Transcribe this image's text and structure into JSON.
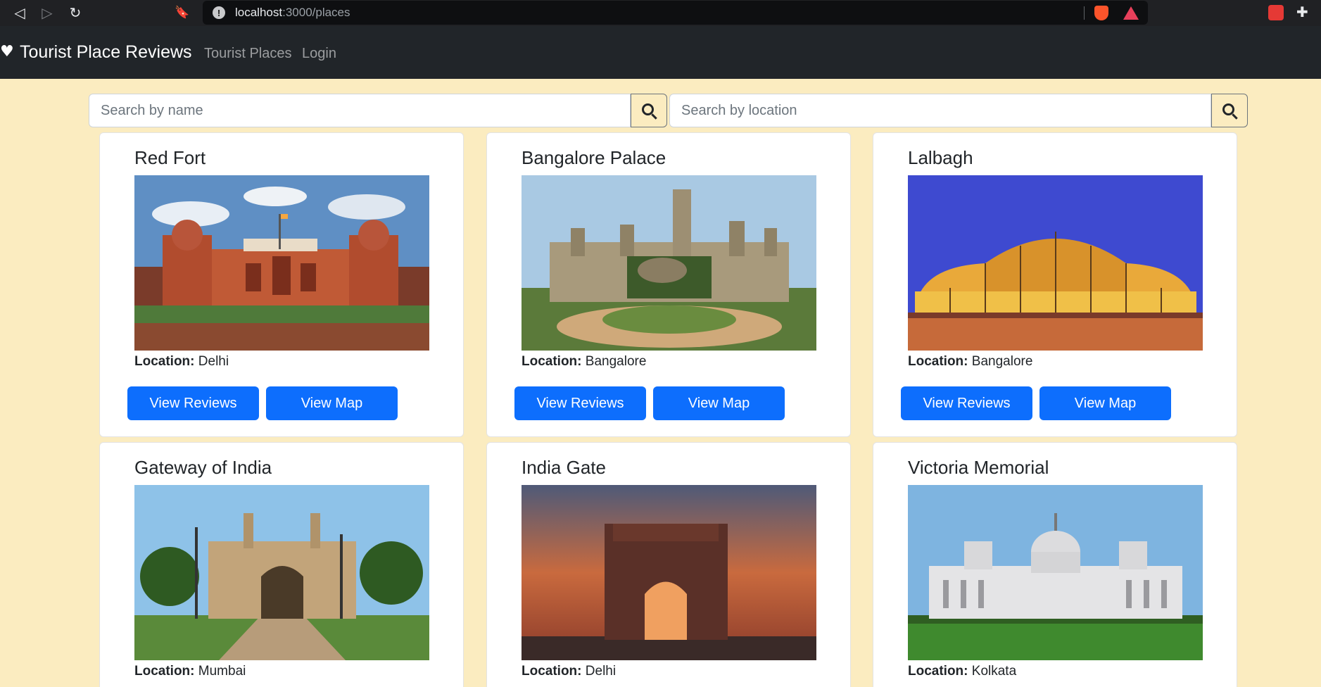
{
  "browser": {
    "url_host": "localhost",
    "url_rest": ":3000/places"
  },
  "navbar": {
    "brand": "Tourist Place Reviews",
    "links": [
      "Tourist Places",
      "Login"
    ]
  },
  "search": {
    "name_placeholder": "Search by name",
    "location_placeholder": "Search by location"
  },
  "location_label": "Location:",
  "buttons": {
    "reviews": "View Reviews",
    "map": "View Map"
  },
  "places": [
    {
      "name": "Red Fort",
      "location": "Delhi"
    },
    {
      "name": "Bangalore Palace",
      "location": "Bangalore"
    },
    {
      "name": "Lalbagh",
      "location": "Bangalore"
    },
    {
      "name": "Gateway of India",
      "location": "Mumbai"
    },
    {
      "name": "India Gate",
      "location": "Delhi"
    },
    {
      "name": "Victoria Memorial",
      "location": "Kolkata"
    }
  ]
}
